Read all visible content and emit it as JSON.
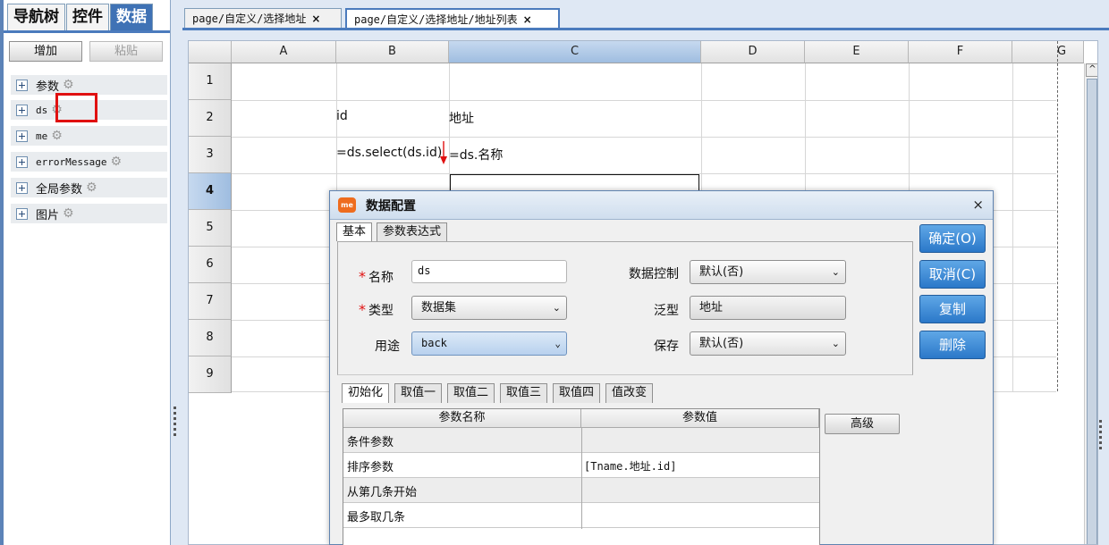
{
  "left_panel": {
    "tabs": [
      {
        "label": "导航树",
        "active": false
      },
      {
        "label": "控件",
        "active": false
      },
      {
        "label": "数据",
        "active": true
      }
    ],
    "add_label": "增加",
    "paste_label": "粘贴",
    "tree": [
      {
        "label": "参数"
      },
      {
        "label": "ds"
      },
      {
        "label": "me"
      },
      {
        "label": "errorMessage"
      },
      {
        "label": "全局参数"
      },
      {
        "label": "图片"
      }
    ]
  },
  "doc_tabs": [
    {
      "label": "page/自定义/选择地址",
      "close": "×",
      "active": false
    },
    {
      "label": "page/自定义/选择地址/地址列表",
      "close": "×",
      "active": true
    }
  ],
  "sheet": {
    "columns": [
      "A",
      "B",
      "C",
      "D",
      "E",
      "F",
      "G"
    ],
    "selected_column": "C",
    "rows": [
      "1",
      "2",
      "3",
      "4",
      "5",
      "6",
      "7",
      "8",
      "9"
    ],
    "selected_row": "4",
    "cells": {
      "B2": "id",
      "C2": "地址",
      "B3": "=ds.select(ds.id)",
      "C3": "=ds.名称"
    },
    "scroll_up": "^"
  },
  "dialog": {
    "title": "数据配置",
    "icon_text": "me",
    "close": "×",
    "tabs": [
      "基本",
      "参数表达式"
    ],
    "fields": {
      "name_label": "名称",
      "name_value": "ds",
      "type_label": "类型",
      "type_value": "数据集",
      "usage_label": "用途",
      "usage_value": "back",
      "data_control_label": "数据控制",
      "data_control_value": "默认(否)",
      "generic_label": "泛型",
      "generic_value": "地址",
      "save_label": "保存",
      "save_value": "默认(否)",
      "required_mark": "*",
      "chevron": "⌄"
    },
    "buttons": {
      "ok": "确定(O)",
      "cancel": "取消(C)",
      "copy": "复制",
      "delete": "删除"
    },
    "sub_tabs": [
      "初始化",
      "取值一",
      "取值二",
      "取值三",
      "取值四",
      "值改变"
    ],
    "param_table": {
      "headers": [
        "参数名称",
        "参数值"
      ],
      "rows": [
        {
          "name": "条件参数",
          "value": ""
        },
        {
          "name": "排序参数",
          "value": "[Tname.地址.id]"
        },
        {
          "name": "从第几条开始",
          "value": ""
        },
        {
          "name": "最多取几条",
          "value": ""
        }
      ]
    },
    "advanced_label": "高级"
  }
}
